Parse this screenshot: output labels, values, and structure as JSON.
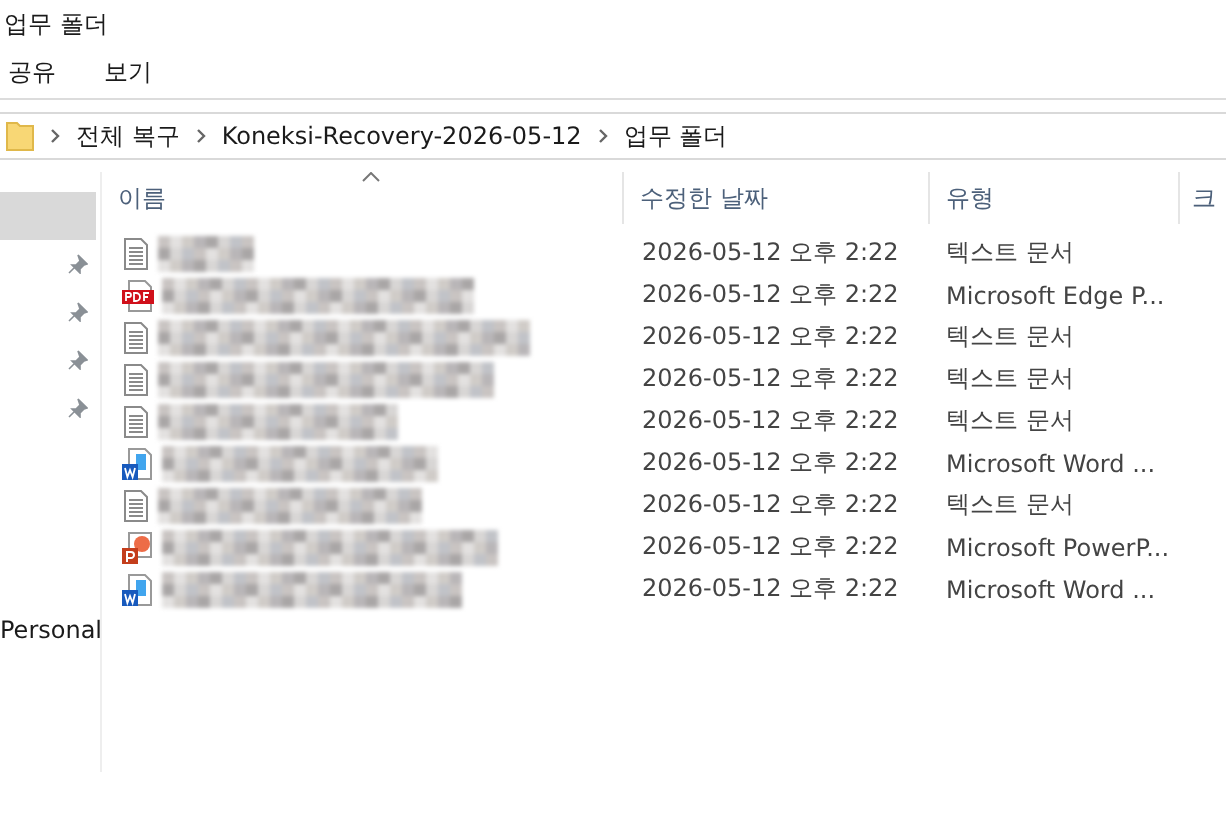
{
  "window": {
    "title": "업무 폴더"
  },
  "ribbon_tabs": [
    {
      "label": "공유",
      "selected": false
    },
    {
      "label": "보기",
      "selected": false
    }
  ],
  "breadcrumb": [
    "전체 복구",
    "Koneksi-Recovery-2026-05-12",
    "업무 폴더"
  ],
  "nav_pane": {
    "items": [
      {
        "selected": true,
        "pinned": false
      },
      {
        "selected": false,
        "pinned": true
      },
      {
        "selected": false,
        "pinned": true
      },
      {
        "selected": false,
        "pinned": true
      },
      {
        "selected": false,
        "pinned": true
      }
    ],
    "footer_label": "Personal"
  },
  "table": {
    "columns": [
      {
        "label": "이름",
        "sorted": true
      },
      {
        "label": "수정한 날짜",
        "sorted": false
      },
      {
        "label": "유형",
        "sorted": false
      },
      {
        "label": "크",
        "sorted": false
      }
    ],
    "rows": [
      {
        "kind": "text",
        "name_redacted": true,
        "modified": "2026-05-12 오후 2:22",
        "type": "텍스트 문서"
      },
      {
        "kind": "pdf",
        "name_redacted": true,
        "modified": "2026-05-12 오후 2:22",
        "type": "Microsoft Edge P..."
      },
      {
        "kind": "text",
        "name_redacted": true,
        "modified": "2026-05-12 오후 2:22",
        "type": "텍스트 문서"
      },
      {
        "kind": "text",
        "name_redacted": true,
        "modified": "2026-05-12 오후 2:22",
        "type": "텍스트 문서"
      },
      {
        "kind": "text",
        "name_redacted": true,
        "modified": "2026-05-12 오후 2:22",
        "type": "텍스트 문서"
      },
      {
        "kind": "word",
        "name_redacted": true,
        "modified": "2026-05-12 오후 2:22",
        "type": "Microsoft Word ..."
      },
      {
        "kind": "text",
        "name_redacted": true,
        "modified": "2026-05-12 오후 2:22",
        "type": "텍스트 문서"
      },
      {
        "kind": "powerpoint",
        "name_redacted": true,
        "modified": "2026-05-12 오후 2:22",
        "type": "Microsoft PowerP..."
      },
      {
        "kind": "word",
        "name_redacted": true,
        "modified": "2026-05-12 오후 2:22",
        "type": "Microsoft Word ..."
      }
    ]
  }
}
